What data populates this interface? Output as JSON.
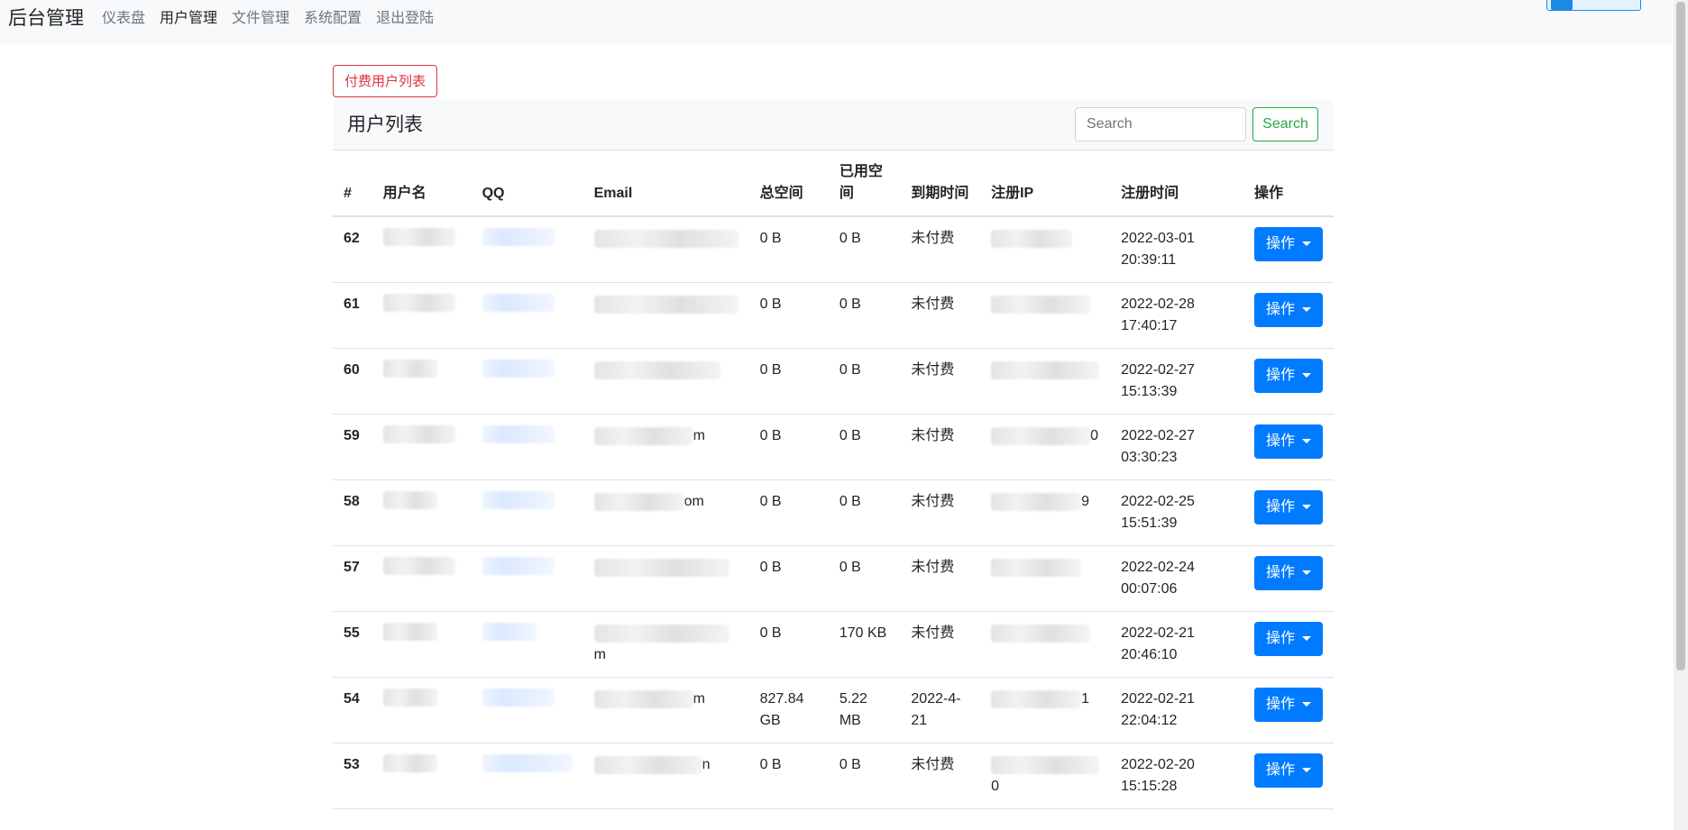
{
  "nav": {
    "brand": "后台管理",
    "items": [
      "仪表盘",
      "用户管理",
      "文件管理",
      "系统配置",
      "退出登陆"
    ],
    "active_index": 1
  },
  "paid_users_button": "付费用户列表",
  "card": {
    "title": "用户列表",
    "search_placeholder": "Search",
    "search_button": "Search"
  },
  "table": {
    "headers": [
      "#",
      "用户名",
      "QQ",
      "Email",
      "总空间",
      "已用空间",
      "到期时间",
      "注册IP",
      "注册时间",
      "操作"
    ],
    "header_used_space_lines": [
      "已用空",
      "间"
    ],
    "action_label": "操作",
    "rows": [
      {
        "id": "62",
        "email_tail": "",
        "total": "0 B",
        "used": "0 B",
        "expire": "未付费",
        "ip_tail": "",
        "reg_date": "2022-03-01",
        "reg_time": "20:39:11"
      },
      {
        "id": "61",
        "email_tail": "",
        "total": "0 B",
        "used": "0 B",
        "expire": "未付费",
        "ip_tail": "",
        "reg_date": "2022-02-28",
        "reg_time": "17:40:17"
      },
      {
        "id": "60",
        "email_tail": "",
        "total": "0 B",
        "used": "0 B",
        "expire": "未付费",
        "ip_tail": "",
        "reg_date": "2022-02-27",
        "reg_time": "15:13:39"
      },
      {
        "id": "59",
        "email_tail": "m",
        "total": "0 B",
        "used": "0 B",
        "expire": "未付费",
        "ip_tail": "0",
        "reg_date": "2022-02-27",
        "reg_time": "03:30:23"
      },
      {
        "id": "58",
        "email_tail": "om",
        "total": "0 B",
        "used": "0 B",
        "expire": "未付费",
        "ip_tail": "9",
        "reg_date": "2022-02-25",
        "reg_time": "15:51:39"
      },
      {
        "id": "57",
        "email_tail": "",
        "total": "0 B",
        "used": "0 B",
        "expire": "未付费",
        "ip_tail": "",
        "reg_date": "2022-02-24",
        "reg_time": "00:07:06"
      },
      {
        "id": "55",
        "email_tail": "m",
        "total": "0 B",
        "used": "170 KB",
        "expire": "未付费",
        "ip_tail": "",
        "reg_date": "2022-02-21",
        "reg_time": "20:46:10"
      },
      {
        "id": "54",
        "email_tail": "m",
        "total": "827.84 GB",
        "used": "5.22 MB",
        "expire": "2022-4-21",
        "ip_tail": "1",
        "reg_date": "2022-02-21",
        "reg_time": "22:04:12"
      },
      {
        "id": "53",
        "email_tail": "n",
        "total": "0 B",
        "used": "0 B",
        "expire": "未付费",
        "ip_tail": "0",
        "reg_date": "2022-02-20",
        "reg_time": "15:15:28"
      }
    ]
  },
  "colors": {
    "primary": "#007bff",
    "danger": "#dc3545",
    "success": "#28a745",
    "nav_bg": "#f8f9fa"
  }
}
